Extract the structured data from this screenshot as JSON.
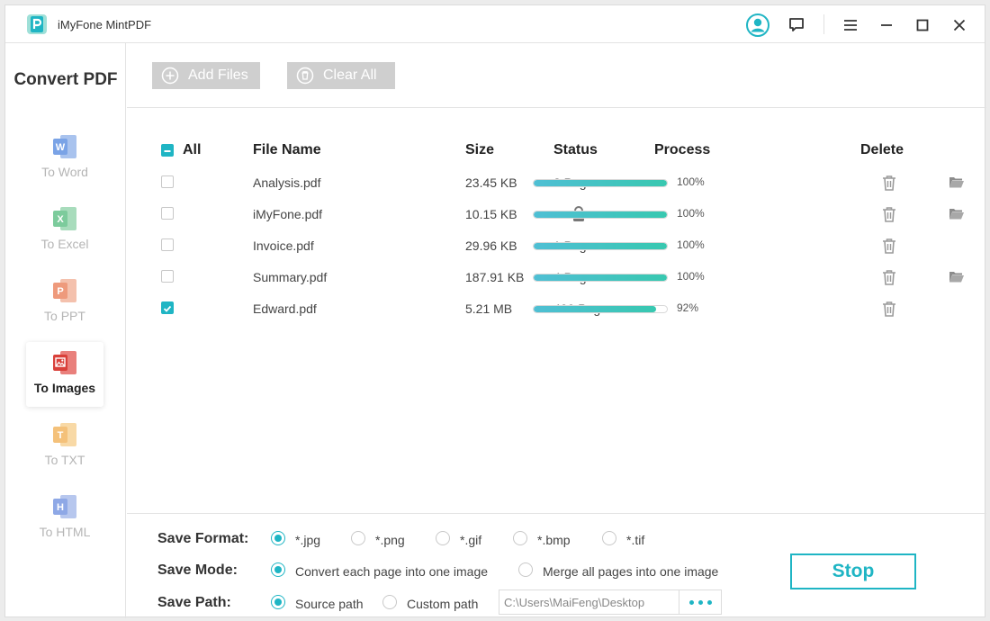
{
  "app": {
    "title": "iMyFone MintPDF",
    "logo_letter": "P"
  },
  "sidebar": {
    "title": "Convert PDF",
    "items": [
      {
        "label": "To Word",
        "letter": "W",
        "color": "#4a7fd4",
        "active": false
      },
      {
        "label": "To Excel",
        "letter": "X",
        "color": "#2e9e5b",
        "active": false
      },
      {
        "label": "To PPT",
        "letter": "P",
        "color": "#e0663c",
        "active": false
      },
      {
        "label": "To Images",
        "letter": "",
        "color": "#d9403a",
        "active": true
      },
      {
        "label": "To TXT",
        "letter": "T",
        "color": "#f0a63a",
        "active": false
      },
      {
        "label": "To HTML",
        "letter": "H",
        "color": "#4a7fd4",
        "active": false
      }
    ]
  },
  "toolbar": {
    "add_label": "Add Files",
    "clear_label": "Clear All"
  },
  "table": {
    "headers": {
      "all": "All",
      "name": "File Name",
      "size": "Size",
      "status": "Status",
      "process": "Process",
      "delete": "Delete"
    },
    "rows": [
      {
        "name": "Analysis.pdf",
        "size": "23.45 KB",
        "status": "2 Pages",
        "locked": false,
        "progress": 1.0,
        "pct": "100%",
        "checked": false,
        "folder": true
      },
      {
        "name": "iMyFone.pdf",
        "size": "10.15 KB",
        "status": "",
        "locked": true,
        "progress": 1.0,
        "pct": "100%",
        "checked": false,
        "folder": true
      },
      {
        "name": "Invoice.pdf",
        "size": "29.96 KB",
        "status": "1 Page",
        "locked": false,
        "progress": 1.0,
        "pct": "100%",
        "checked": false,
        "folder": false
      },
      {
        "name": "Summary.pdf",
        "size": "187.91 KB",
        "status": "4 Pages",
        "locked": false,
        "progress": 1.0,
        "pct": "100%",
        "checked": false,
        "folder": true
      },
      {
        "name": "Edward.pdf",
        "size": "5.21 MB",
        "status": "499 Pages",
        "locked": false,
        "progress": 0.92,
        "pct": "92%",
        "checked": true,
        "folder": false
      }
    ]
  },
  "options": {
    "format": {
      "label": "Save Format:",
      "choices": [
        "*.jpg",
        "*.png",
        "*.gif",
        "*.bmp",
        "*.tif"
      ],
      "selected": 0
    },
    "mode": {
      "label": "Save Mode:",
      "choices": [
        "Convert each page into one image",
        "Merge all pages into one image"
      ],
      "selected": 0
    },
    "path": {
      "label": "Save Path:",
      "choices": [
        "Source path",
        "Custom path"
      ],
      "selected": 0,
      "value": "C:\\Users\\MaiFeng\\Desktop"
    },
    "stop_label": "Stop"
  },
  "colors": {
    "accent": "#1fb5c4",
    "progress_start": "#4fbfd4",
    "progress_end": "#38c8b0",
    "button_disabled": "#cfcfcf"
  }
}
